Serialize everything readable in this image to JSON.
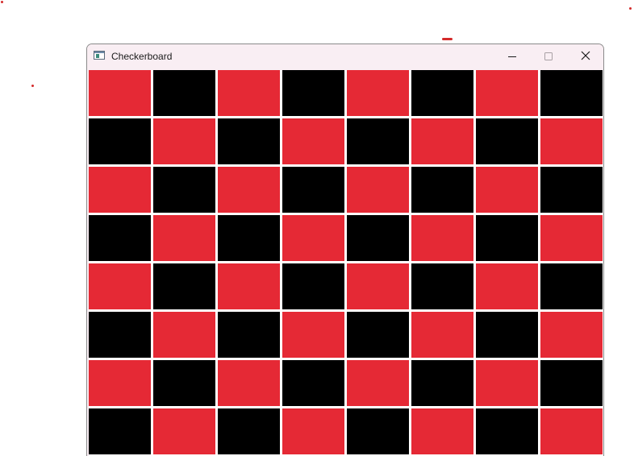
{
  "window": {
    "title": "Checkerboard",
    "icon": "app-window-icon",
    "controls": {
      "minimize_icon": "minimize-icon",
      "maximize_icon": "maximize-icon",
      "close_icon": "close-icon"
    }
  },
  "board": {
    "rows": 8,
    "cols": 8,
    "first_square_color": "#e52935",
    "second_square_color": "#000000",
    "grid_line_color": "#ffffff"
  },
  "colors": {
    "accent_red": "#e52935",
    "black": "#000000",
    "titlebar_bg": "#f9eef3",
    "stray_mark": "#d42a2a"
  }
}
